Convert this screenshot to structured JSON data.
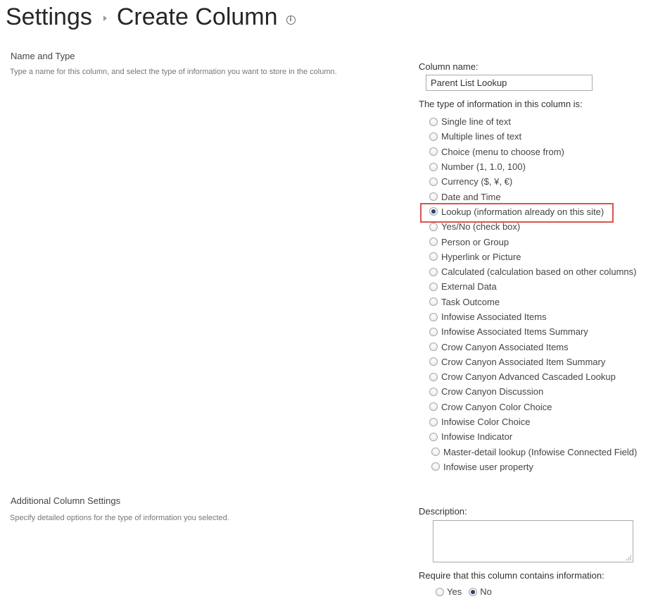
{
  "header": {
    "breadcrumb_root": "Settings",
    "page_title": "Create Column"
  },
  "name_and_type": {
    "section_title": "Name and Type",
    "section_desc": "Type a name for this column, and select the type of information you want to store in the column.",
    "column_name_label": "Column name:",
    "column_name_value": "Parent List Lookup",
    "type_label": "The type of information in this column is:",
    "selected_type": "Lookup (information already on this site)",
    "types": [
      {
        "label": "Single line of text",
        "checked": false
      },
      {
        "label": "Multiple lines of text",
        "checked": false
      },
      {
        "label": "Choice (menu to choose from)",
        "checked": false
      },
      {
        "label": "Number (1, 1.0, 100)",
        "checked": false
      },
      {
        "label": "Currency ($, ¥, €)",
        "checked": false
      },
      {
        "label": "Date and Time",
        "checked": false
      },
      {
        "label": "Lookup (information already on this site)",
        "checked": true
      },
      {
        "label": "Yes/No (check box)",
        "checked": false
      },
      {
        "label": "Person or Group",
        "checked": false
      },
      {
        "label": "Hyperlink or Picture",
        "checked": false
      },
      {
        "label": "Calculated (calculation based on other columns)",
        "checked": false
      },
      {
        "label": "External Data",
        "checked": false
      },
      {
        "label": "Task Outcome",
        "checked": false
      },
      {
        "label": "Infowise Associated Items",
        "checked": false
      },
      {
        "label": "Infowise Associated Items Summary",
        "checked": false
      },
      {
        "label": "Crow Canyon Associated Items",
        "checked": false
      },
      {
        "label": "Crow Canyon Associated Item Summary",
        "checked": false
      },
      {
        "label": "Crow Canyon Advanced Cascaded Lookup",
        "checked": false
      },
      {
        "label": "Crow Canyon Discussion",
        "checked": false
      },
      {
        "label": "Crow Canyon Color Choice",
        "checked": false
      },
      {
        "label": "Infowise Color Choice",
        "checked": false
      },
      {
        "label": "Infowise Indicator",
        "checked": false
      },
      {
        "label": "Master-detail lookup (Infowise Connected Field)",
        "checked": false
      },
      {
        "label": "Infowise user property",
        "checked": false
      }
    ]
  },
  "additional_settings": {
    "section_title": "Additional Column Settings",
    "section_desc": "Specify detailed options for the type of information you selected.",
    "description_label": "Description:",
    "description_value": "",
    "require_label": "Require that this column contains information:",
    "require_yes": "Yes",
    "require_no": "No",
    "require_value": "No"
  },
  "colors": {
    "highlight_border": "#d9534f",
    "radio_selected": "#2b3f6b"
  }
}
